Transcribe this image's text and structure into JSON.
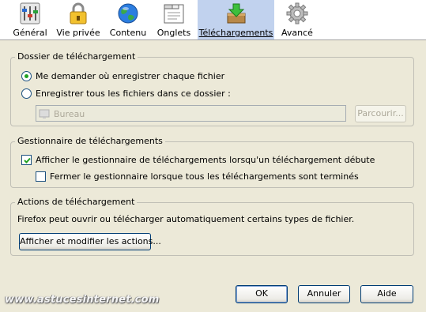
{
  "toolbar": {
    "tabs": [
      {
        "label": "Général",
        "icon": "general-settings-icon"
      },
      {
        "label": "Vie privée",
        "icon": "padlock-icon"
      },
      {
        "label": "Contenu",
        "icon": "globe-icon"
      },
      {
        "label": "Onglets",
        "icon": "tabs-window-icon"
      },
      {
        "label": "Téléchargements",
        "icon": "download-box-icon",
        "selected": true
      },
      {
        "label": "Avancé",
        "icon": "gear-icon"
      }
    ]
  },
  "download_folder": {
    "title": "Dossier de téléchargement",
    "ask_label": "Me demander où enregistrer chaque fichier",
    "ask_selected": true,
    "save_to_label": "Enregistrer tous les fichiers dans ce dossier :",
    "folder_value": "Bureau",
    "browse_label": "Parcourir..."
  },
  "download_manager": {
    "title": "Gestionnaire de téléchargements",
    "show_label": "Afficher le gestionnaire de téléchargements lorsqu'un téléchargement débute",
    "show_checked": true,
    "close_label": "Fermer le gestionnaire lorsque tous les téléchargements sont terminés",
    "close_checked": false
  },
  "download_actions": {
    "title": "Actions de téléchargement",
    "description": "Firefox peut ouvrir ou télécharger automatiquement certains types de fichier.",
    "view_actions_label": "Afficher et modifier les actions..."
  },
  "footer": {
    "ok_label": "OK",
    "cancel_label": "Annuler",
    "help_label": "Aide",
    "watermark": "www.astucesinternet.com"
  },
  "colors": {
    "background": "#ece9d8",
    "selected_tab": "#c1d2ee",
    "radio_dot": "#21a121",
    "check_mark": "#21a121"
  }
}
